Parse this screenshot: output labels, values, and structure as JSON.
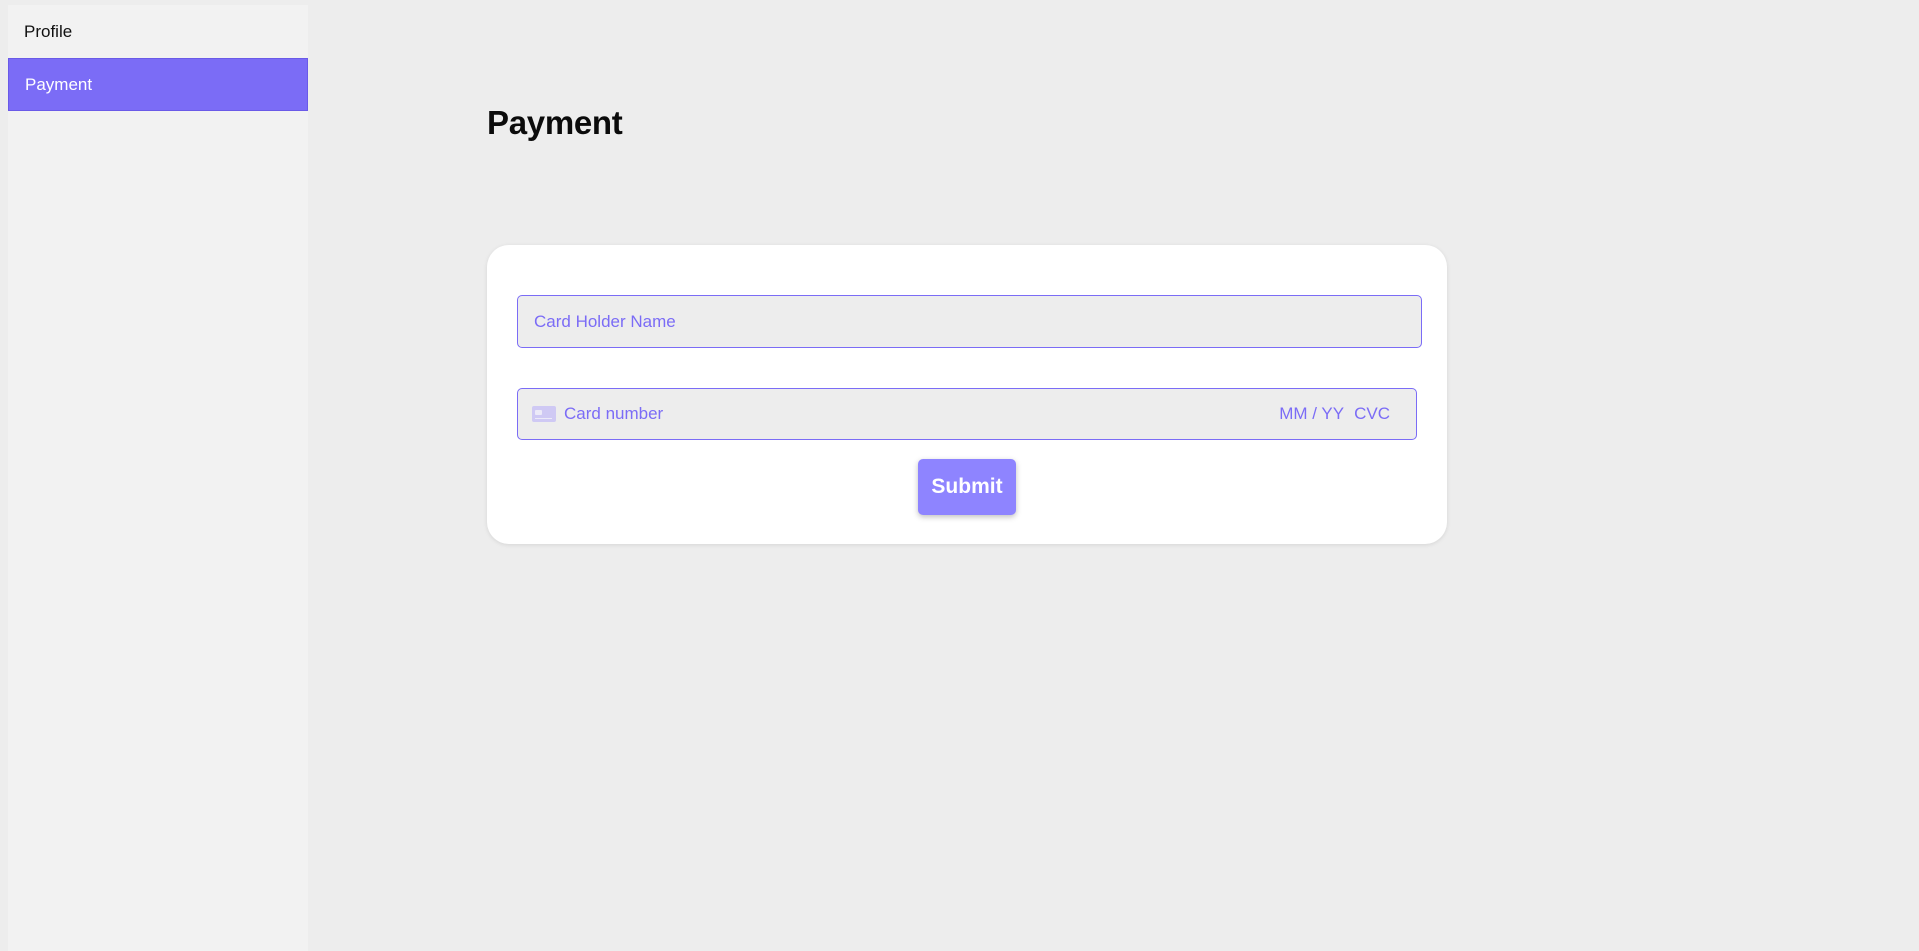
{
  "sidebar": {
    "items": [
      {
        "label": "Profile",
        "active": false
      },
      {
        "label": "Payment",
        "active": true
      }
    ]
  },
  "main": {
    "title": "Payment"
  },
  "form": {
    "card_holder_placeholder": "Card Holder Name",
    "card_number_placeholder": "Card number",
    "expiry_placeholder": "MM / YY",
    "cvc_placeholder": "CVC",
    "submit_label": "Submit"
  },
  "colors": {
    "accent": "#7b6cf6",
    "button": "#8e84ff",
    "background": "#ededed",
    "sidebar": "#f2f2f2",
    "card": "#ffffff"
  },
  "icons": {
    "card_icon": "credit-card-icon"
  }
}
